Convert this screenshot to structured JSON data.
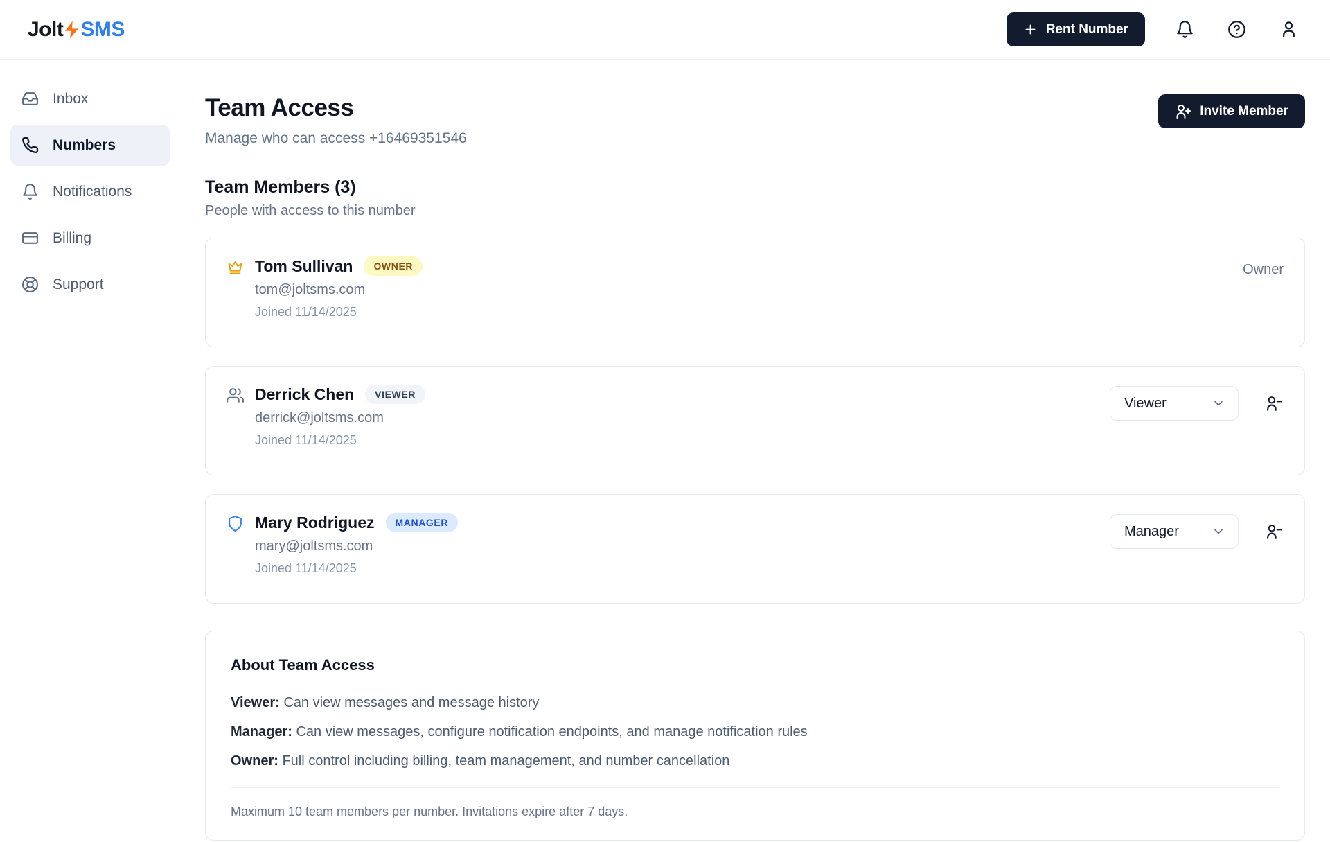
{
  "brand": {
    "jolt": "Jolt",
    "sms": "SMS"
  },
  "topnav": {
    "rent_number_label": "Rent Number"
  },
  "sidebar": {
    "items": [
      {
        "label": "Inbox",
        "icon": "inbox-icon",
        "active": false
      },
      {
        "label": "Numbers",
        "icon": "phone-icon",
        "active": true
      },
      {
        "label": "Notifications",
        "icon": "bell-icon",
        "active": false
      },
      {
        "label": "Billing",
        "icon": "credit-card-icon",
        "active": false
      },
      {
        "label": "Support",
        "icon": "life-buoy-icon",
        "active": false
      }
    ]
  },
  "page": {
    "title": "Team Access",
    "subtitle": "Manage who can access +16469351546",
    "invite_label": "Invite Member"
  },
  "section": {
    "title": "Team Members (3)",
    "subtitle": "People with access to this number"
  },
  "members": [
    {
      "name": "Tom Sullivan",
      "badge": "OWNER",
      "icon": "crown-icon",
      "email": "tom@joltsms.com",
      "joined": "Joined 11/14/2025",
      "right_text": "Owner"
    },
    {
      "name": "Derrick Chen",
      "badge": "VIEWER",
      "icon": "users-icon",
      "email": "derrick@joltsms.com",
      "joined": "Joined 11/14/2025",
      "role_select": "Viewer"
    },
    {
      "name": "Mary Rodriguez",
      "badge": "MANAGER",
      "icon": "shield-icon",
      "email": "mary@joltsms.com",
      "joined": "Joined 11/14/2025",
      "role_select": "Manager"
    }
  ],
  "about": {
    "title": "About Team Access",
    "roles": [
      {
        "term": "Viewer:",
        "desc": " Can view messages and message history"
      },
      {
        "term": "Manager:",
        "desc": " Can view messages, configure notification endpoints, and manage notification rules"
      },
      {
        "term": "Owner:",
        "desc": " Full control including billing, team management, and number cancellation"
      }
    ],
    "footnote": "Maximum 10 team members per number. Invitations expire after 7 days."
  },
  "colors": {
    "nav_dark": "#131c2e",
    "logo_blue": "#2f80ed",
    "bolt_orange": "#f97316",
    "crown_amber": "#e7a50f",
    "shield_blue": "#3b82f6",
    "owner_badge_bg": "#fef9c3",
    "owner_badge_text": "#854d0e",
    "viewer_badge_bg": "#f1f4f8",
    "viewer_badge_text": "#334155",
    "manager_badge_bg": "#dbeafe",
    "manager_badge_text": "#1d4ed8",
    "sidebar_active_bg": "#eef2f8"
  }
}
